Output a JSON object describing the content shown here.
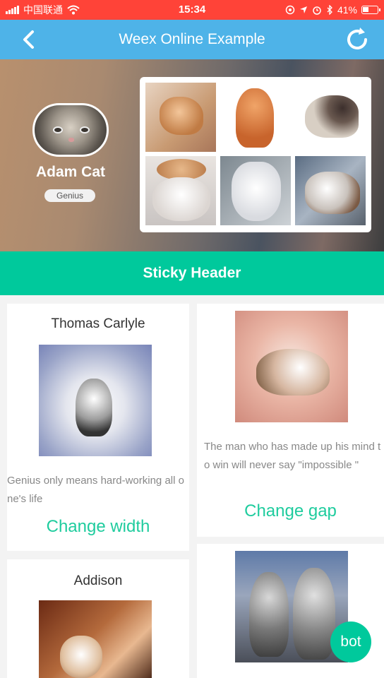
{
  "status_bar": {
    "carrier": "中国联通",
    "time": "15:34",
    "battery_percent": "41%",
    "battery_level": 0.41,
    "icons": [
      "signal-icon",
      "wifi-icon",
      "at-icon",
      "location-arrow-icon",
      "alarm-icon",
      "bluetooth-icon",
      "battery-icon"
    ]
  },
  "nav": {
    "title": "Weex Online Example",
    "back_icon": "back-arrow-icon",
    "refresh_icon": "refresh-icon",
    "color": "#4eb3e8"
  },
  "profile": {
    "name": "Adam Cat",
    "tag": "Genius"
  },
  "gallery": {
    "count": 6
  },
  "sticky_header": {
    "label": "Sticky Header",
    "color": "#00c99c"
  },
  "cards": [
    {
      "title": "Thomas Carlyle",
      "text": "Genius only means hard-working all one's life",
      "action": "Change width"
    },
    {
      "title": "",
      "text": "The man who has made up his mind to win will never say \"impossible \"",
      "action": "Change gap"
    },
    {
      "title": "Addison",
      "text": "",
      "action": ""
    },
    {
      "title": "",
      "text": "",
      "action": ""
    }
  ],
  "fab": {
    "label": "bot",
    "color": "#00c99c"
  },
  "accent_color": "#1fcc9e",
  "status_color": "#ff4338"
}
